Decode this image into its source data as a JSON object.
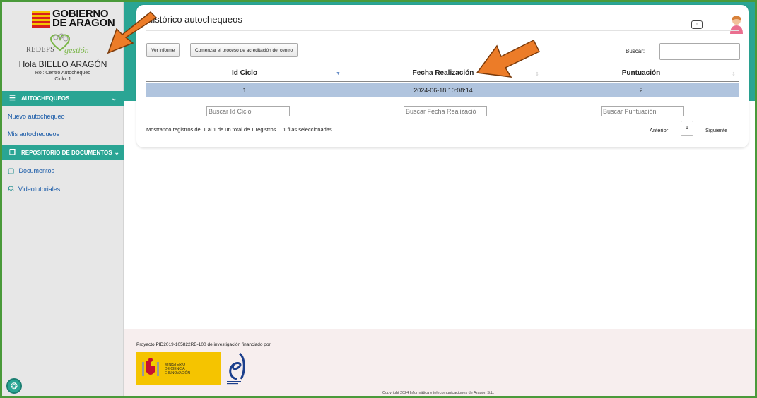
{
  "sidebar": {
    "logo_text": "GOBIERNO\nDE ARAGON",
    "logo_line1": "GOBIERNO",
    "logo_line2": "DE ARAGON",
    "brand_left": "REDEPS",
    "brand_right": "gestión",
    "hello": "Hola BIELLO ARAGÓN",
    "role": "Rol: Centro Autochequeo",
    "cycle": "Ciclo: 1",
    "sections": [
      {
        "label": "AUTOCHEQUEOS",
        "icon": "list-icon",
        "items": [
          "Nuevo autochequeo",
          "Mis autochequeos"
        ]
      },
      {
        "label": "REPOSITORIO DE DOCUMENTOS",
        "icon": "book-icon"
      }
    ],
    "links": [
      {
        "label": "Documentos",
        "icon": "document-icon"
      },
      {
        "label": "Videotutoriales",
        "icon": "headphones-icon"
      }
    ]
  },
  "main": {
    "title": "Histórico autochequeos",
    "buttons": {
      "report": "Ver informe",
      "accredit": "Comenzar el proceso de acreditación del centro"
    },
    "search_label": "Buscar:",
    "table": {
      "columns": [
        "Id Ciclo",
        "Fecha Realización",
        "Puntuación"
      ],
      "rows": [
        [
          "1",
          "2024-06-18 10:08:14",
          "2"
        ]
      ],
      "filters": [
        "Buscar Id Ciclo",
        "Buscar Fecha Realizació",
        "Buscar Puntuación"
      ]
    },
    "info": "Mostrando registros del 1 al 1 de un total de 1 registros",
    "selected": "1 filas seleccionadas",
    "pager": {
      "prev": "Anterior",
      "page": "1",
      "next": "Siguiente"
    }
  },
  "footer": {
    "project": "Proyecto PID2019-105822RB-100 de investigación financiado por:",
    "ministry": "MINISTERIO\nDE CIENCIA\nE INNOVACIÓN",
    "ministry_l1": "MINISTERIO",
    "ministry_l2": "DE CIENCIA",
    "ministry_l3": "E INNOVACIÓN",
    "copyright": "Copyright 2024 Informática y telecomunicaciones de Aragón S.L."
  },
  "colors": {
    "accent": "#2aa594",
    "selected_row": "#b0c4de",
    "arrow": "#ec7c28",
    "border": "#4a9a3a"
  }
}
